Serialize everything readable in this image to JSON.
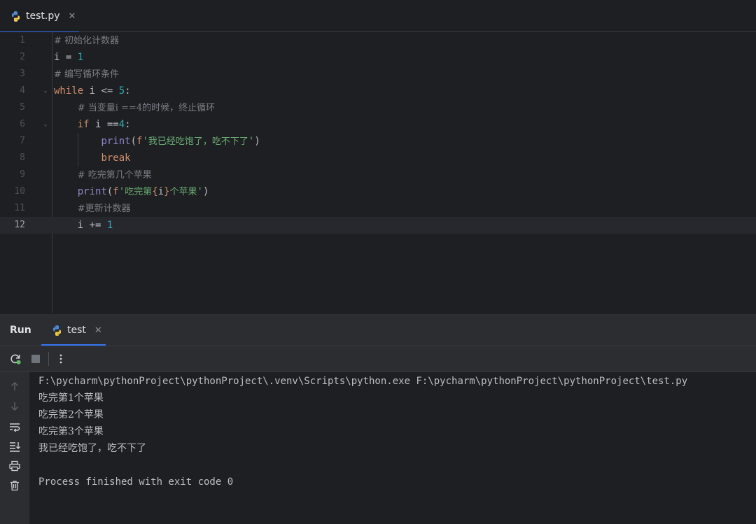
{
  "editor_tab": {
    "label": "test.py",
    "close": "✕"
  },
  "code_lines": [
    {
      "num": "1",
      "parts": [
        [
          "cm",
          "# 初始化计数器"
        ]
      ]
    },
    {
      "num": "2",
      "parts": [
        [
          "plain",
          "i = "
        ],
        [
          "num",
          "1"
        ]
      ]
    },
    {
      "num": "3",
      "parts": [
        [
          "cm",
          "# 编写循环条件"
        ]
      ]
    },
    {
      "num": "4",
      "parts": [
        [
          "kw",
          "while"
        ],
        [
          "plain",
          " i <= "
        ],
        [
          "num",
          "5"
        ],
        [
          "plain",
          ":"
        ]
      ]
    },
    {
      "num": "5",
      "parts": [
        [
          "plain",
          "    "
        ],
        [
          "cm",
          "# 当变量i ==4的时候，终止循环"
        ]
      ]
    },
    {
      "num": "6",
      "parts": [
        [
          "plain",
          "    "
        ],
        [
          "kw",
          "if"
        ],
        [
          "plain",
          " i =="
        ],
        [
          "num",
          "4"
        ],
        [
          "plain",
          ":"
        ]
      ]
    },
    {
      "num": "7",
      "parts": [
        [
          "plain",
          "        "
        ],
        [
          "bi",
          "print"
        ],
        [
          "plain",
          "("
        ],
        [
          "fx",
          "f"
        ],
        [
          "str",
          "'"
        ],
        [
          "strcjk",
          "我已经吃饱了，吃不下了"
        ],
        [
          "str",
          "'"
        ],
        [
          "plain",
          ")"
        ]
      ]
    },
    {
      "num": "8",
      "parts": [
        [
          "plain",
          "        "
        ],
        [
          "kw",
          "break"
        ]
      ]
    },
    {
      "num": "9",
      "parts": [
        [
          "plain",
          "    "
        ],
        [
          "cm",
          "# 吃完第几个苹果"
        ]
      ]
    },
    {
      "num": "10",
      "parts": [
        [
          "plain",
          "    "
        ],
        [
          "bi",
          "print"
        ],
        [
          "plain",
          "("
        ],
        [
          "fx",
          "f"
        ],
        [
          "str",
          "'"
        ],
        [
          "strcjk",
          "吃完第"
        ],
        [
          "fx",
          "{"
        ],
        [
          "plain",
          "i"
        ],
        [
          "fx",
          "}"
        ],
        [
          "strcjk",
          "个苹果"
        ],
        [
          "str",
          "'"
        ],
        [
          "plain",
          ")"
        ]
      ]
    },
    {
      "num": "11",
      "parts": [
        [
          "plain",
          "    "
        ],
        [
          "cm",
          "#更新计数器"
        ]
      ]
    },
    {
      "num": "12",
      "parts": [
        [
          "plain",
          "    i += "
        ],
        [
          "num",
          "1"
        ]
      ]
    }
  ],
  "run_panel": {
    "title": "Run",
    "tab_label": "test",
    "tab_close": "✕"
  },
  "console_lines": [
    "F:\\pycharm\\pythonProject\\pythonProject\\.venv\\Scripts\\python.exe F:\\pycharm\\pythonProject\\pythonProject\\test.py",
    "吃完第1个苹果",
    "吃完第2个苹果",
    "吃完第3个苹果",
    "我已经吃饱了，吃不下了",
    "",
    "Process finished with exit code 0"
  ],
  "icons": {
    "python": "python-icon",
    "rerun": "rerun-icon",
    "stop": "stop-icon",
    "more": "more-vertical-icon",
    "up": "arrow-up-icon",
    "down": "arrow-down-icon",
    "wrap": "soft-wrap-icon",
    "scroll": "scroll-to-end-icon",
    "print": "print-icon",
    "trash": "trash-icon"
  },
  "colors": {
    "accent": "#3574f0",
    "keyword": "#cf8e6d",
    "number": "#2aacb8",
    "string": "#6aab73",
    "comment": "#7a7e85",
    "builtin": "#8888c6"
  }
}
